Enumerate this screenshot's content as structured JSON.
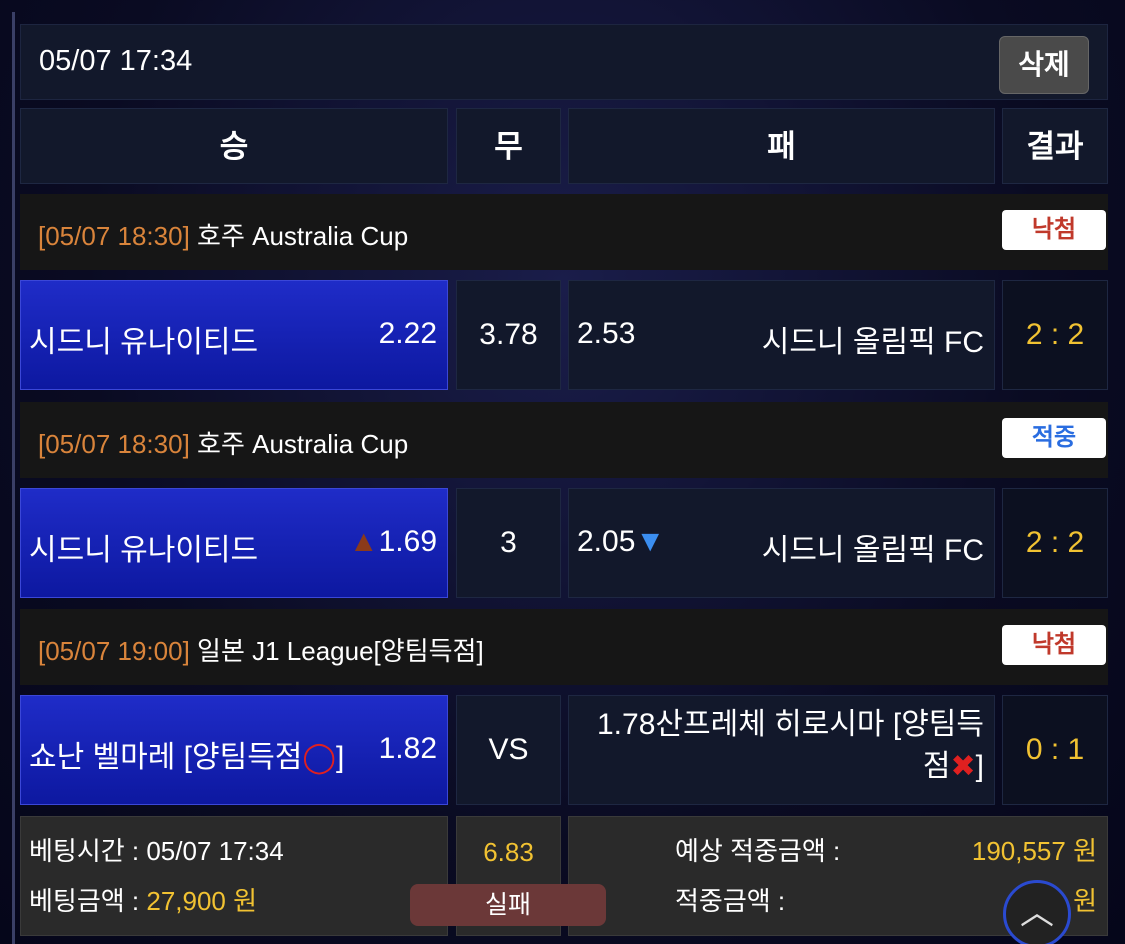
{
  "header": {
    "time": "05/07 17:34",
    "delete_label": "삭제"
  },
  "columns": {
    "win": "승",
    "draw": "무",
    "lose": "패",
    "result": "결과"
  },
  "matches": [
    {
      "time": "[05/07 18:30]",
      "league": "호주 Australia Cup",
      "status": "낙첨",
      "home": "시드니 유나이티드",
      "home_odds": "2.22",
      "draw": "3.78",
      "away_odds": "2.53",
      "away": "시드니 올림픽 FC",
      "score": "2 : 2"
    },
    {
      "time": "[05/07 18:30]",
      "league": "호주 Australia Cup",
      "status": "적중",
      "home": "시드니 유나이티드",
      "home_odds": "1.69",
      "draw": "3",
      "away_odds": "2.05",
      "away": "시드니 올림픽 FC",
      "score": "2 : 2"
    },
    {
      "time": "[05/07 19:00]",
      "league": "일본 J1 League[양팀득점]",
      "status": "낙첨",
      "home": "쇼난 벨마레 [양팀득점",
      "home_odds": "1.82",
      "draw": "VS",
      "away_odds": "1.78",
      "away_line1": "산프레체 히로시마 [양팀득",
      "away_line2": "점",
      "score": "0 : 1"
    }
  ],
  "footer": {
    "bet_time_label": "베팅시간 : 05/07 17:34",
    "bet_amount_label": "베팅금액 : ",
    "bet_amount": "27,900 원",
    "total_odds": "6.83",
    "result": "실패",
    "expected_label": "예상 적중금액 :",
    "expected_amount": "190,557 원",
    "win_label": "적중금액 :",
    "win_amount": "0 원"
  },
  "icons": {
    "odds_up": "arrow-up-icon",
    "odds_down": "arrow-down-icon",
    "hit": "circle-icon",
    "miss": "cross-icon",
    "scroll_top": "chevron-up-icon"
  },
  "colors": {
    "home_bg": "#1f2cc8",
    "score": "#f1c232",
    "league_time": "#d9843b",
    "lose": "#c0392b",
    "win": "#2a6de0"
  }
}
